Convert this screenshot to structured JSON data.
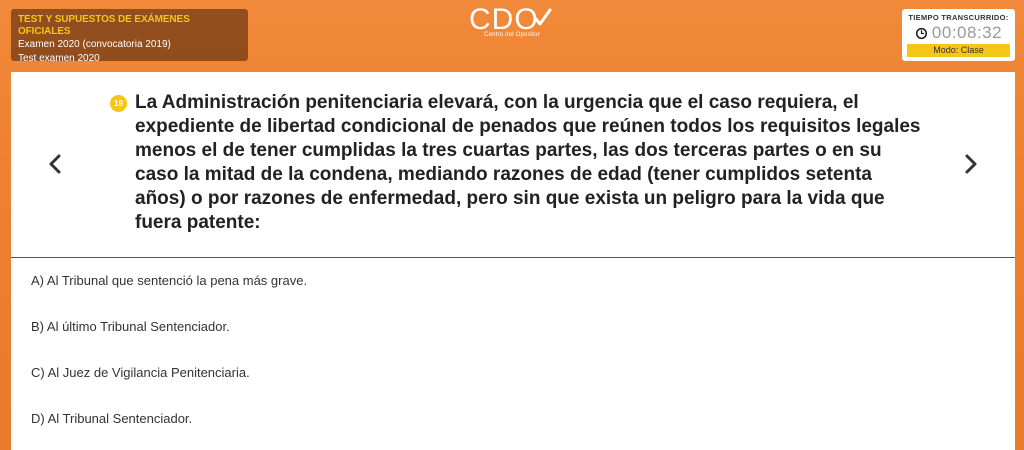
{
  "header": {
    "title": "TEST Y SUPUESTOS DE EXÁMENES OFICIALES",
    "exam": "Examen 2020 (convocatoria 2019)",
    "test": "Test examen 2020"
  },
  "logo": {
    "text": "CDO",
    "subtitle": "Centro del Opositor"
  },
  "timer": {
    "label": "TIEMPO TRANSCURRIDO:",
    "value": "00:08:32",
    "mode": "Modo: Clase"
  },
  "question": {
    "number": "19",
    "text": "La Administración penitenciaria elevará, con la urgencia que el caso requiera, el expediente de libertad condicional de penados que reúnen todos los requisitos legales menos el de tener cumplidas la tres cuartas partes, las dos terceras partes o en su caso la mitad de la condena, mediando razones de edad (tener cumplidos setenta años) o por razones de enfermedad, pero sin que exista un peligro para la vida que fuera patente:"
  },
  "options": [
    "A) Al Tribunal que sentenció la pena más grave.",
    "B) Al último Tribunal Sentenciador.",
    "C) Al Juez de Vigilancia Penitenciaria.",
    "D) Al Tribunal Sentenciador."
  ],
  "icons": {
    "prev": "chevron-left-icon",
    "next": "chevron-right-icon",
    "clock": "clock-icon"
  },
  "colors": {
    "background": "#ee8030",
    "accent": "#f5c518"
  }
}
